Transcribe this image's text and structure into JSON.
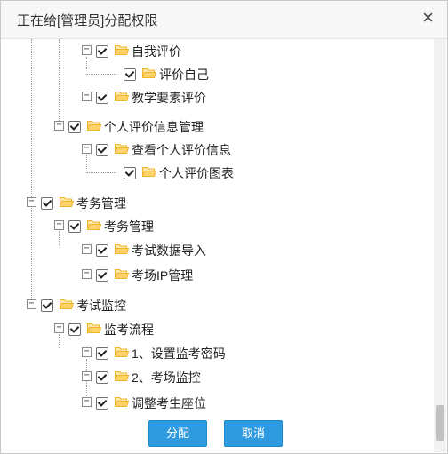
{
  "dialog": {
    "title": "正在给[管理员]分配权限",
    "close_symbol": "×"
  },
  "tree": [
    {
      "key": "n1",
      "label": "自我评价",
      "checked": true,
      "icon": "folder-open-icon"
    },
    {
      "key": "n2",
      "label": "评价自己",
      "checked": true,
      "icon": "folder-open-icon"
    },
    {
      "key": "n3",
      "label": "教学要素评价",
      "checked": true,
      "icon": "folder-open-icon"
    },
    {
      "key": "n4",
      "label": "个人评价信息管理",
      "checked": true,
      "icon": "folder-open-icon"
    },
    {
      "key": "n5",
      "label": "查看个人评价信息",
      "checked": true,
      "icon": "folder-open-icon"
    },
    {
      "key": "n6",
      "label": "个人评价图表",
      "checked": true,
      "icon": "folder-open-icon"
    },
    {
      "key": "n7",
      "label": "考务管理",
      "checked": true,
      "icon": "folder-open-icon"
    },
    {
      "key": "n8",
      "label": "考务管理",
      "checked": true,
      "icon": "folder-open-icon"
    },
    {
      "key": "n9",
      "label": "考试数据导入",
      "checked": true,
      "icon": "folder-open-icon"
    },
    {
      "key": "n10",
      "label": "考场IP管理",
      "checked": true,
      "icon": "folder-open-icon"
    },
    {
      "key": "n11",
      "label": "考试监控",
      "checked": true,
      "icon": "folder-open-icon"
    },
    {
      "key": "n12",
      "label": "监考流程",
      "checked": true,
      "icon": "folder-open-icon"
    },
    {
      "key": "n13",
      "label": "1、设置监考密码",
      "checked": true,
      "icon": "folder-open-icon"
    },
    {
      "key": "n14",
      "label": "2、考场监控",
      "checked": true,
      "icon": "folder-open-icon"
    },
    {
      "key": "n15",
      "label": "调整考生座位",
      "checked": true,
      "icon": "folder-open-icon"
    }
  ],
  "toggle_symbol": "−",
  "buttons": {
    "assign": "分配",
    "cancel": "取消"
  },
  "colors": {
    "primary_button": "#2e9ae0",
    "folder": "#f0b429"
  }
}
